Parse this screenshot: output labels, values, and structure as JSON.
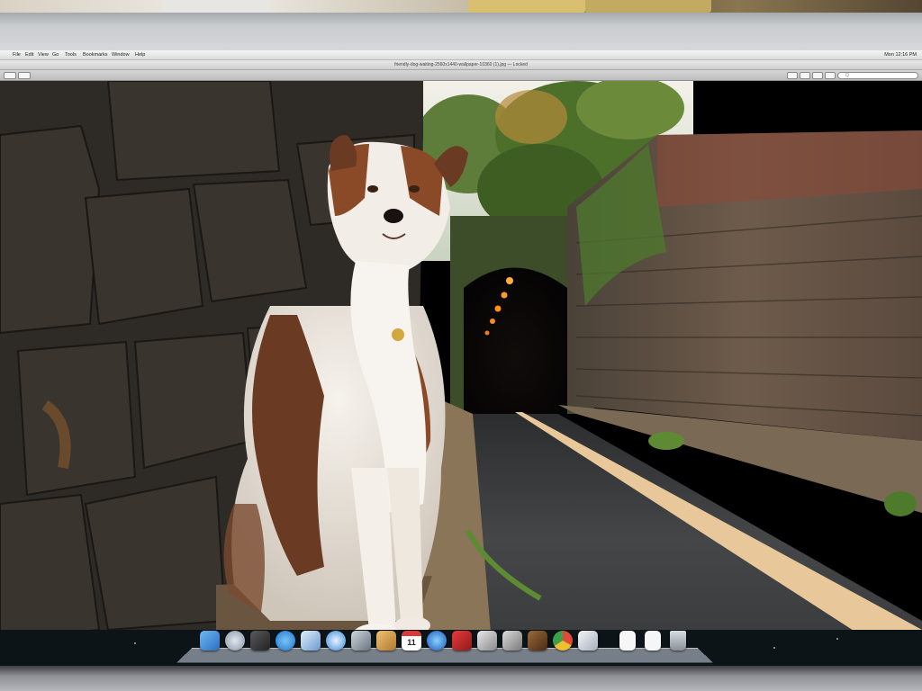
{
  "menubar": {
    "apple_symbol": "",
    "menus": [
      "File",
      "Edit",
      "View",
      "Go",
      "Tools",
      "Bookmarks",
      "Window",
      "Help"
    ],
    "clock": "Mon 12:16 PM"
  },
  "window": {
    "title": "friendly-dog-waiting-2560x1440-wallpaper-10360 (1).jpg — Locked",
    "search_placeholder": "Q"
  },
  "dock": {
    "icons": [
      "finder-icon",
      "launchpad-icon",
      "photo-booth-icon",
      "app-store-icon",
      "preview-icon",
      "safari-icon",
      "facetime-icon",
      "book-icon",
      "calendar-icon",
      "itunes-icon",
      "photo-icon",
      "screenshot-icon",
      "image-capture-icon",
      "wallet-icon",
      "chrome-icon",
      "photos-icon",
      "document-icon",
      "document-icon",
      "trash-icon"
    ],
    "calendar_day": "11"
  },
  "colors": {
    "road": "#3a3b3d",
    "road_line": "#e8c89a",
    "wall_dark": "#2e2a26",
    "brick": "#8a5a44",
    "foliage": "#4e7a2c",
    "dog_white": "#f2ede6",
    "dog_brown": "#6b3a22"
  }
}
